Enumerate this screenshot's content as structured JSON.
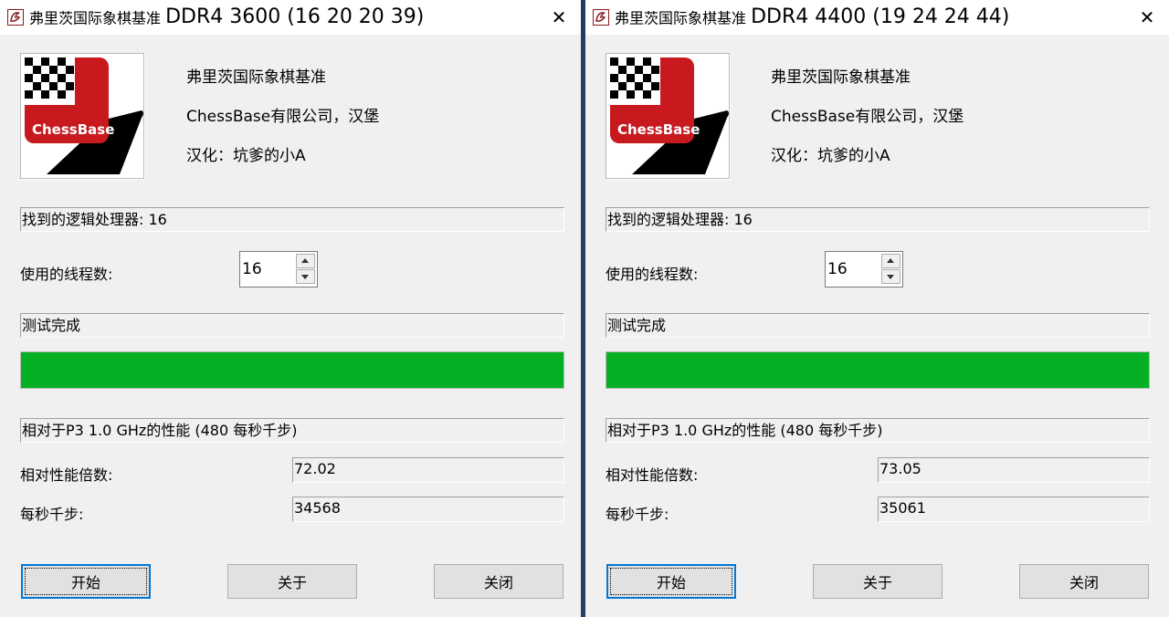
{
  "colors": {
    "progress": "#06b025",
    "accent": "#0078d7",
    "logo_red": "#c8191f"
  },
  "windows": [
    {
      "title_cn": "弗里茨国际象棋基准",
      "title_main": "DDR4 3600  (16 20 20 39)",
      "logo_text": "ChessBase",
      "info": [
        "弗里茨国际象棋基准",
        "ChessBase有限公司，汉堡",
        "汉化：坑爹的小A"
      ],
      "processors_found": "找到的逻辑处理器: 16",
      "threads_label": "使用的线程数:",
      "threads_value": "16",
      "status": "测试完成",
      "progress_percent": 100,
      "relative_header": "相对于P3 1.0 GHz的性能 (480 每秒千步)",
      "factor_label": "相对性能倍数:",
      "factor_value": "72.02",
      "kns_label": "每秒千步:",
      "kns_value": "34568",
      "buttons": {
        "start": "开始",
        "about": "关于",
        "close": "关闭"
      }
    },
    {
      "title_cn": "弗里茨国际象棋基准",
      "title_main": "DDR4 4400  (19 24 24 44)",
      "logo_text": "ChessBase",
      "info": [
        "弗里茨国际象棋基准",
        "ChessBase有限公司，汉堡",
        "汉化：坑爹的小A"
      ],
      "processors_found": "找到的逻辑处理器: 16",
      "threads_label": "使用的线程数:",
      "threads_value": "16",
      "status": "测试完成",
      "progress_percent": 100,
      "relative_header": "相对于P3 1.0 GHz的性能 (480 每秒千步)",
      "factor_label": "相对性能倍数:",
      "factor_value": "73.05",
      "kns_label": "每秒千步:",
      "kns_value": "35061",
      "buttons": {
        "start": "开始",
        "about": "关于",
        "close": "关闭"
      }
    }
  ]
}
